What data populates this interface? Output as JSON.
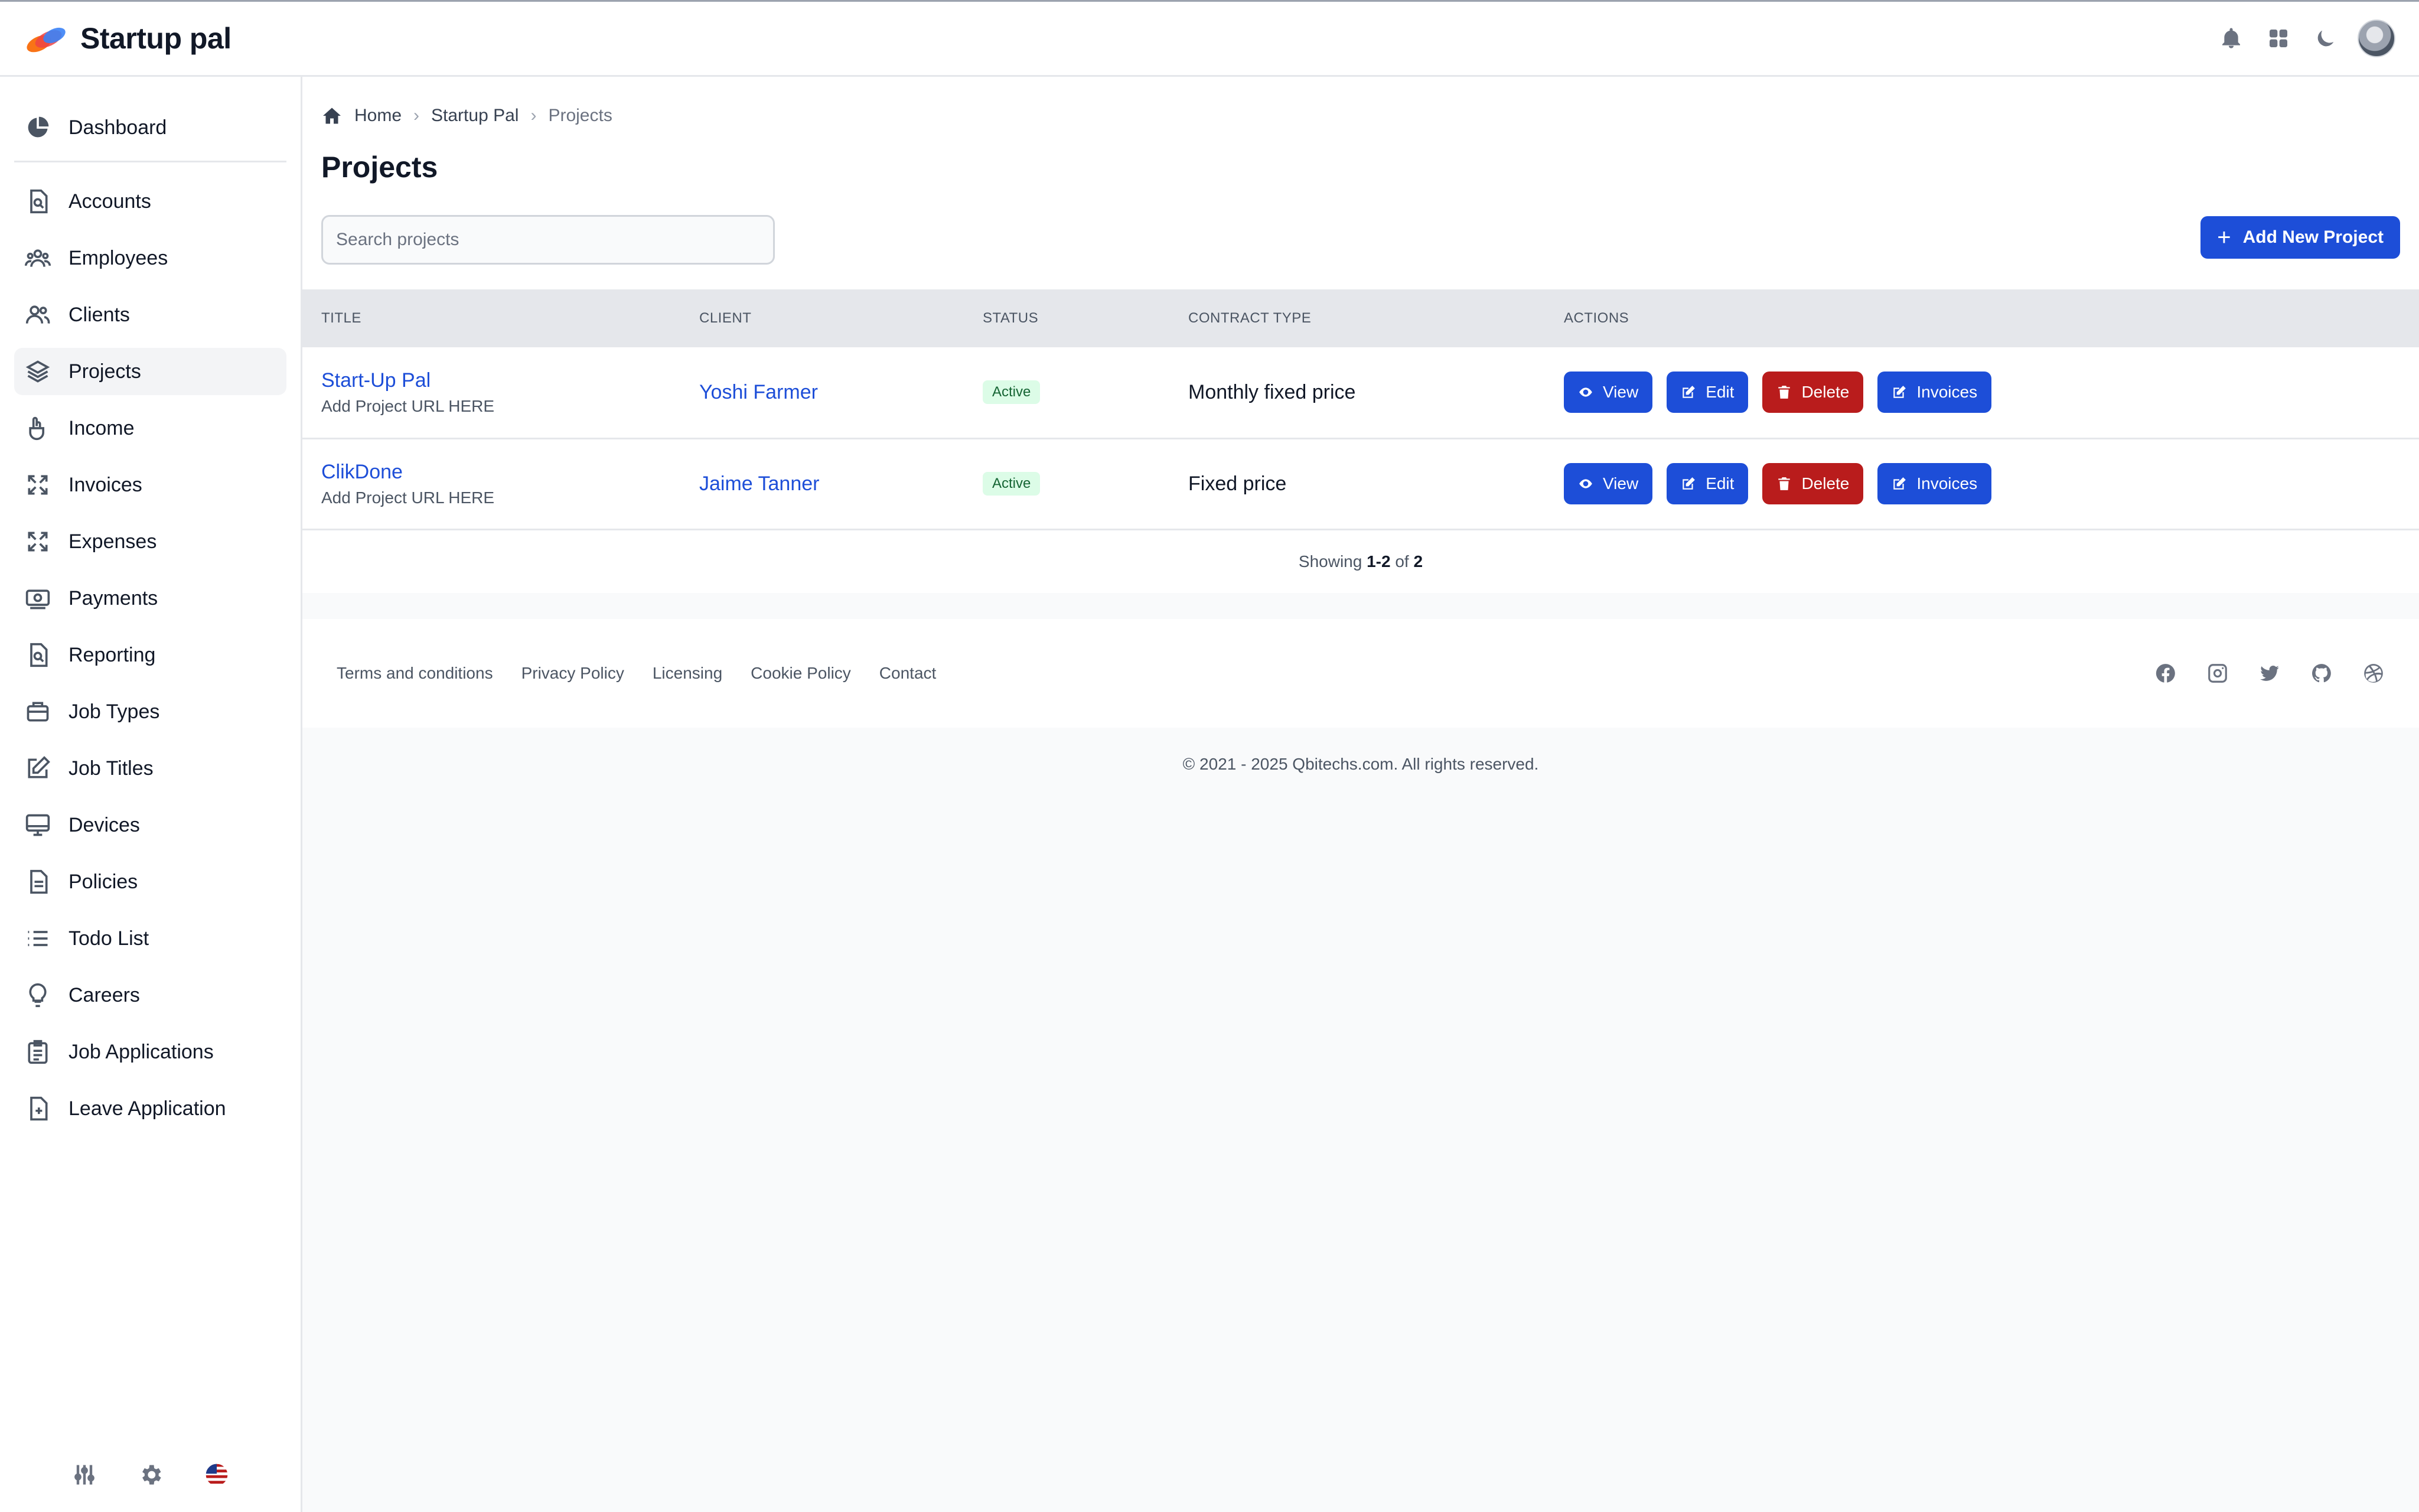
{
  "app": {
    "name": "Startup pal"
  },
  "sidebar": {
    "items": [
      {
        "label": "Dashboard",
        "icon": "pie-chart-icon"
      },
      {
        "label": "Accounts",
        "icon": "document-search-icon"
      },
      {
        "label": "Employees",
        "icon": "users-group-icon"
      },
      {
        "label": "Clients",
        "icon": "users-icon"
      },
      {
        "label": "Projects",
        "icon": "layers-icon",
        "active": true
      },
      {
        "label": "Income",
        "icon": "hand-coin-icon"
      },
      {
        "label": "Invoices",
        "icon": "expand-icon"
      },
      {
        "label": "Expenses",
        "icon": "expand-icon"
      },
      {
        "label": "Payments",
        "icon": "cash-icon"
      },
      {
        "label": "Reporting",
        "icon": "document-search-icon"
      },
      {
        "label": "Job Types",
        "icon": "briefcase-icon"
      },
      {
        "label": "Job Titles",
        "icon": "pencil-square-icon"
      },
      {
        "label": "Devices",
        "icon": "desktop-icon"
      },
      {
        "label": "Policies",
        "icon": "document-icon"
      },
      {
        "label": "Todo List",
        "icon": "list-icon"
      },
      {
        "label": "Careers",
        "icon": "lightbulb-icon"
      },
      {
        "label": "Job Applications",
        "icon": "clipboard-icon"
      },
      {
        "label": "Leave Application",
        "icon": "document-plus-icon"
      }
    ]
  },
  "breadcrumb": {
    "home": "Home",
    "parent": "Startup Pal",
    "current": "Projects"
  },
  "page": {
    "title": "Projects",
    "search_placeholder": "Search projects",
    "add_button": "Add New Project"
  },
  "table": {
    "headers": {
      "title": "TITLE",
      "client": "CLIENT",
      "status": "STATUS",
      "contract": "CONTRACT TYPE",
      "actions": "ACTIONS"
    },
    "rows": [
      {
        "title": "Start-Up Pal",
        "url": "Add Project URL HERE",
        "client": "Yoshi Farmer",
        "status": "Active",
        "contract": "Monthly fixed price"
      },
      {
        "title": "ClikDone",
        "url": "Add Project URL HERE",
        "client": "Jaime Tanner",
        "status": "Active",
        "contract": "Fixed price"
      }
    ],
    "action_labels": {
      "view": "View",
      "edit": "Edit",
      "delete": "Delete",
      "invoices": "Invoices"
    },
    "pagination": {
      "prefix": "Showing",
      "range": "1-2",
      "of": "of",
      "total": "2"
    }
  },
  "footer": {
    "links": [
      "Terms and conditions",
      "Privacy Policy",
      "Licensing",
      "Cookie Policy",
      "Contact"
    ],
    "social": [
      "facebook-icon",
      "instagram-icon",
      "twitter-icon",
      "github-icon",
      "dribbble-icon"
    ],
    "copyright": "© 2021 - 2025 Qbitechs.com. All rights reserved."
  },
  "colors": {
    "primary": "#1d4ed8",
    "danger": "#b91c1c",
    "success_bg": "#dcfce7",
    "success_text": "#166534"
  }
}
